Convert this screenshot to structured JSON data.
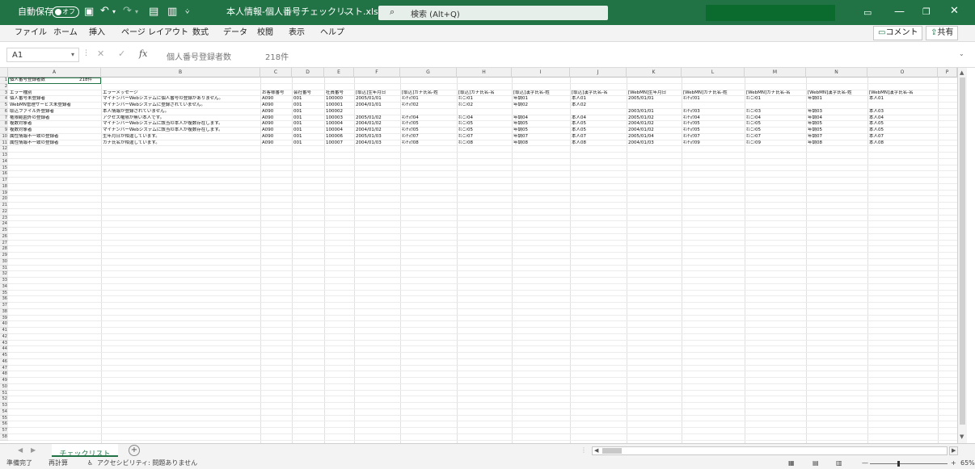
{
  "title_bar": {
    "autosave_label": "自動保存",
    "autosave_state": "オフ",
    "filename": "本人情報-個人番号チェックリスト.xlsx",
    "search_placeholder": "検索 (Alt+Q)",
    "accent": "#217346"
  },
  "ribbon": {
    "tabs": [
      "ファイル",
      "ホーム",
      "挿入",
      "ページ レイアウト",
      "数式",
      "データ",
      "校閲",
      "表示",
      "ヘルプ"
    ],
    "comment_label": "コメント",
    "share_label": "共有"
  },
  "formula_bar": {
    "name_box": "A1",
    "fx": "fx",
    "formula_text": "個人番号登録者数",
    "formula_value": "218件"
  },
  "columns": [
    "A",
    "B",
    "C",
    "D",
    "E",
    "F",
    "G",
    "H",
    "I",
    "J",
    "K",
    "L",
    "M",
    "N",
    "O",
    "P"
  ],
  "row_count": 58,
  "cells": {
    "a1": "個人番号登録者数",
    "b1": "218件",
    "headers": [
      "エラー種別",
      "エラーメッセージ",
      "お客様番号",
      "会社番号",
      "社員番号",
      "[取込]生年月日",
      "[取込]カナ氏名-姓",
      "[取込]カナ氏名-名",
      "[取込]漢字氏名-姓",
      "[取込]漢字氏名-名",
      "[WebMN]生年月日",
      "[WebMN]カナ氏名-姓",
      "[WebMN]カナ氏名-名",
      "[WebMN]漢字氏名-姓",
      "[WebMN]漢字氏名-名"
    ],
    "rows": [
      [
        "個人番号未登録者",
        "マイナンバーWebシステムに個人番号の登録がありません。",
        "A090",
        "001",
        "100000",
        "2005/01/01",
        "ﾈﾝﾁｮｳ01",
        "ﾎﾝﾆﾝ01",
        "年調01",
        "本人01",
        "2005/01/01",
        "ﾈﾝﾁｮｳ01",
        "ﾎﾝﾆﾝ01",
        "年調01",
        "本人01"
      ],
      [
        "WebMN管理サービス未登録者",
        "マイナンバーWebシステムに登録されていません。",
        "A090",
        "001",
        "100001",
        "2004/01/01",
        "ﾈﾝﾁｮｳ02",
        "ﾎﾝﾆﾝ02",
        "年調02",
        "本人02",
        "",
        "",
        "",
        "",
        ""
      ],
      [
        "取込ファイル外登録者",
        "本人情報が登録されていません。",
        "A090",
        "001",
        "100002",
        "",
        "",
        "",
        "",
        "",
        "2003/01/01",
        "ﾈﾝﾁｮｳ03",
        "ﾎﾝﾆﾝ03",
        "年調03",
        "本人03"
      ],
      [
        "権限範囲外の登録者",
        "アクセス権限が無い本人です。",
        "A090",
        "001",
        "100003",
        "2005/01/02",
        "ﾈﾝﾁｮｳ04",
        "ﾎﾝﾆﾝ04",
        "年調04",
        "本人04",
        "2005/01/02",
        "ﾈﾝﾁｮｳ04",
        "ﾎﾝﾆﾝ04",
        "年調04",
        "本人04"
      ],
      [
        "複数対象者",
        "マイナンバーWebシステムに該当の本人が複数存在します。",
        "A090",
        "001",
        "100004",
        "2004/01/02",
        "ﾈﾝﾁｮｳ05",
        "ﾎﾝﾆﾝ05",
        "年調05",
        "本人05",
        "2004/01/02",
        "ﾈﾝﾁｮｳ05",
        "ﾎﾝﾆﾝ05",
        "年調05",
        "本人05"
      ],
      [
        "複数対象者",
        "マイナンバーWebシステムに該当の本人が複数存在します。",
        "A090",
        "001",
        "100004",
        "2004/01/02",
        "ﾈﾝﾁｮｳ05",
        "ﾎﾝﾆﾝ05",
        "年調05",
        "本人05",
        "2004/01/02",
        "ﾈﾝﾁｮｳ05",
        "ﾎﾝﾆﾝ05",
        "年調05",
        "本人05"
      ],
      [
        "属性情報不一致の登録者",
        "生年月日が相違しています。",
        "A090",
        "001",
        "100006",
        "2005/01/03",
        "ﾈﾝﾁｮｳ07",
        "ﾎﾝﾆﾝ07",
        "年調07",
        "本人07",
        "2005/01/04",
        "ﾈﾝﾁｮｳ07",
        "ﾎﾝﾆﾝ07",
        "年調07",
        "本人07"
      ],
      [
        "属性情報不一致の登録者",
        "カナ氏名が相違しています。",
        "A090",
        "001",
        "100007",
        "2004/01/03",
        "ﾈﾝﾁｮｳ08",
        "ﾎﾝﾆﾝ08",
        "年調08",
        "本人08",
        "2004/01/03",
        "ﾈﾝﾁｮｳ09",
        "ﾎﾝﾆﾝ09",
        "年調08",
        "本人08"
      ]
    ]
  },
  "sheet_tabs": {
    "active": "チェックリスト",
    "add": "+"
  },
  "status_bar": {
    "ready": "準備完了",
    "calc": "再計算",
    "accessibility": "アクセシビリティ: 問題ありません",
    "zoom": "65%"
  }
}
